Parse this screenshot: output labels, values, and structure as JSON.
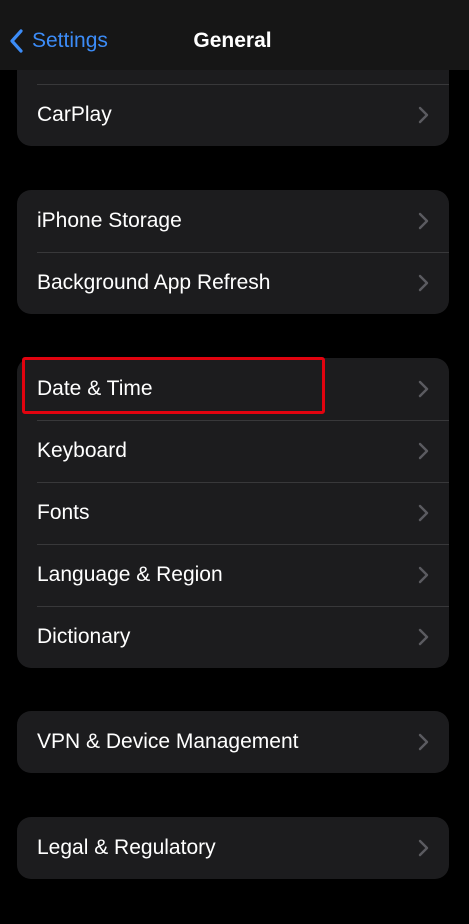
{
  "navbar": {
    "back_label": "Settings",
    "title": "General"
  },
  "groups": [
    {
      "rows": [
        {
          "label": "CarPlay"
        }
      ]
    },
    {
      "rows": [
        {
          "label": "iPhone Storage"
        },
        {
          "label": "Background App Refresh"
        }
      ]
    },
    {
      "rows": [
        {
          "label": "Date & Time"
        },
        {
          "label": "Keyboard"
        },
        {
          "label": "Fonts"
        },
        {
          "label": "Language & Region"
        },
        {
          "label": "Dictionary"
        }
      ]
    },
    {
      "rows": [
        {
          "label": "VPN & Device Management"
        }
      ]
    },
    {
      "rows": [
        {
          "label": "Legal & Regulatory"
        }
      ]
    }
  ],
  "colors": {
    "accent": "#3c8cf7",
    "background": "#000000",
    "group_background": "#1c1c1e",
    "highlight": "#e1030f"
  },
  "icons": {
    "back": "chevron-left-icon",
    "row": "chevron-right-icon"
  }
}
